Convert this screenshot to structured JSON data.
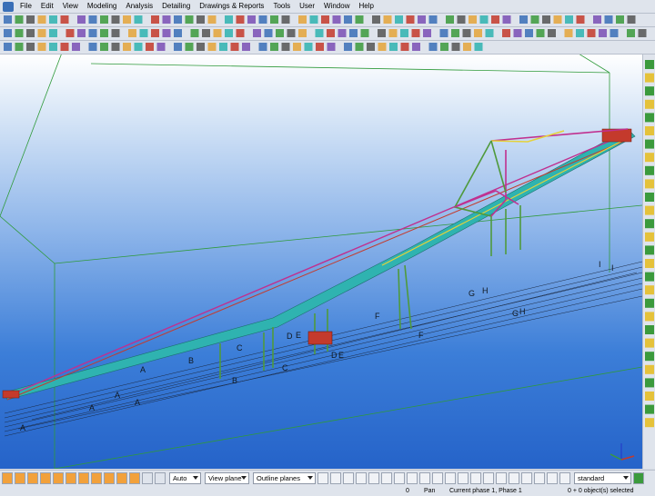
{
  "menu": {
    "items": [
      "File",
      "Edit",
      "View",
      "Modeling",
      "Analysis",
      "Detailing",
      "Drawings & Reports",
      "Tools",
      "User",
      "Window",
      "Help"
    ]
  },
  "bottom_toolbar": {
    "select_auto": "Auto",
    "select_view_plane": "View plane",
    "select_outline_planes": "Outline planes",
    "select_standard": "standard"
  },
  "status": {
    "coord": "0",
    "mode": "Pan",
    "phase": "Current phase 1, Phase 1",
    "selection": "0 + 0 object(s) selected"
  },
  "viewport": {
    "grid_labels": [
      "A",
      "A",
      "A",
      "A",
      "A",
      "B",
      "B",
      "C",
      "C",
      "D",
      "D",
      "E",
      "E",
      "F",
      "F",
      "G",
      "G",
      "H",
      "H",
      "I",
      "I"
    ]
  },
  "colors": {
    "sky_top": "#ffffff",
    "sky_bottom": "#2563c9",
    "steel_cyan": "#2fb3b0",
    "steel_magenta": "#c0308f",
    "steel_green": "#4f9a3c",
    "steel_red": "#c43a2c",
    "steel_yellow": "#e5d23a"
  }
}
